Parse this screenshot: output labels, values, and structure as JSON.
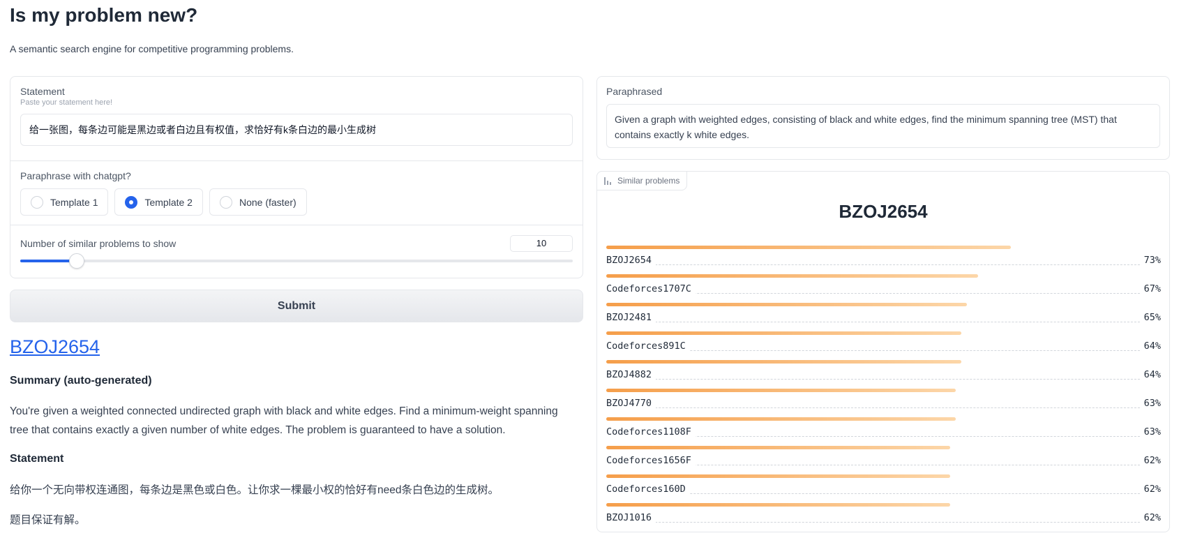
{
  "header": {
    "title": "Is my problem new?",
    "subtitle": "A semantic search engine for competitive programming problems."
  },
  "statement": {
    "label": "Statement",
    "hint": "Paste your statement here!",
    "value": "给一张图，每条边可能是黑边或者白边且有权值，求恰好有k条白边的最小生成树"
  },
  "paraphrase": {
    "label": "Paraphrase with chatgpt?",
    "options": [
      "Template 1",
      "Template 2",
      "None (faster)"
    ],
    "selected": "Template 2"
  },
  "slider": {
    "label": "Number of similar problems to show",
    "value": "10",
    "fill_fraction": 0.102
  },
  "submit_label": "Submit",
  "result": {
    "title": "BZOJ2654",
    "summary_heading": "Summary (auto-generated)",
    "summary_text": "You're given a weighted connected undirected graph with black and white edges. Find a minimum-weight spanning tree that contains exactly a given number of white edges. The problem is guaranteed to have a solution.",
    "statement_heading": "Statement",
    "statement_line1": "给你一个无向带权连通图，每条边是黑色或白色。让你求一棵最小权的恰好有need条白色边的生成树。",
    "statement_line2": "题目保证有解。"
  },
  "paraphrased": {
    "label": "Paraphrased",
    "value": "Given a graph with weighted edges, consisting of black and white edges, find the minimum spanning tree (MST) that contains exactly k white edges."
  },
  "similar": {
    "tag": "Similar problems",
    "title": "BZOJ2654",
    "items": [
      {
        "name": "BZOJ2654",
        "pct": "73%",
        "value": 0.73
      },
      {
        "name": "Codeforces1707C",
        "pct": "67%",
        "value": 0.67
      },
      {
        "name": "BZOJ2481",
        "pct": "65%",
        "value": 0.65
      },
      {
        "name": "Codeforces891C",
        "pct": "64%",
        "value": 0.64
      },
      {
        "name": "BZOJ4882",
        "pct": "64%",
        "value": 0.64
      },
      {
        "name": "BZOJ4770",
        "pct": "63%",
        "value": 0.63
      },
      {
        "name": "Codeforces1108F",
        "pct": "63%",
        "value": 0.63
      },
      {
        "name": "Codeforces1656F",
        "pct": "62%",
        "value": 0.62
      },
      {
        "name": "Codeforces160D",
        "pct": "62%",
        "value": 0.62
      },
      {
        "name": "BZOJ1016",
        "pct": "62%",
        "value": 0.62
      }
    ]
  },
  "colors": {
    "accent": "#2563eb",
    "bar_start": "#f59e4a",
    "bar_end": "#fcd6a8"
  }
}
